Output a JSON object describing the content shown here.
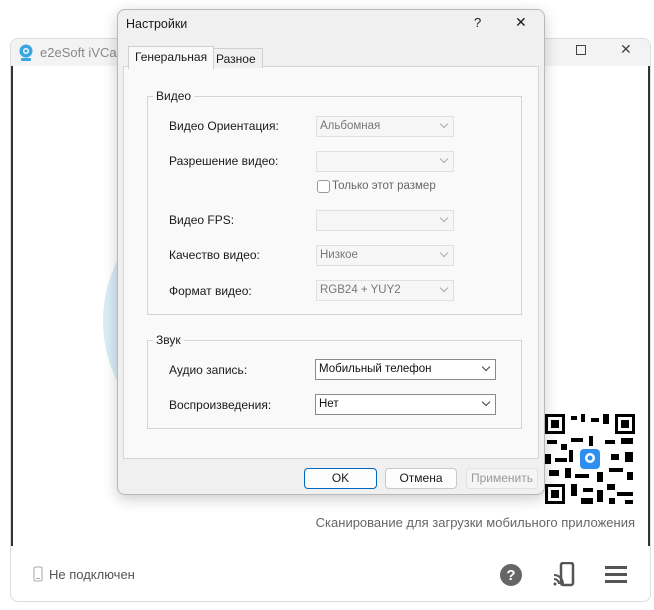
{
  "main_window": {
    "title": "e2eSoft iVCam",
    "scan_text": "Сканирование для загрузки мобильного приложения",
    "status": "Не подключен"
  },
  "dialog": {
    "title": "Настройки",
    "help": "?",
    "close": "✕",
    "tabs": [
      "Генеральная",
      "Разное"
    ],
    "video_group": {
      "legend": "Видео",
      "orientation_label": "Видео Ориентация:",
      "orientation_value": "Альбомная",
      "resolution_label": "Разрешение видео:",
      "resolution_value": "",
      "only_size_label": "Только этот размер",
      "fps_label": "Видео FPS:",
      "fps_value": "",
      "quality_label": "Качество видео:",
      "quality_value": "Низкое",
      "format_label": "Формат видео:",
      "format_value": "RGB24 + YUY2"
    },
    "sound_group": {
      "legend": "Звук",
      "record_label": "Аудио запись:",
      "record_value": "Мобильный телефон",
      "playback_label": "Воспроизведения:",
      "playback_value": "Нет"
    },
    "buttons": {
      "ok": "OK",
      "cancel": "Отмена",
      "apply": "Применить"
    }
  },
  "colors": {
    "accent": "#0067c0",
    "circle": "#d8edf5",
    "app_icon": "#2a9fd8"
  }
}
